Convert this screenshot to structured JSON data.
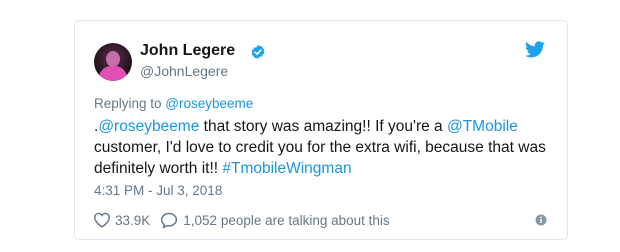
{
  "tweet": {
    "author_name": "John Legere",
    "handle": "@JohnLegere",
    "replying_prefix": "Replying to ",
    "replying_to": "@roseybeeme",
    "text": {
      "p1": ".",
      "mention1": "@roseybeeme",
      "p2": " that story was amazing!! If you're a ",
      "mention2": "@TMobile",
      "p3": " customer, I'd love to credit you for the extra wifi, because that was definitely worth it!! ",
      "hashtag": "#TmobileWingman"
    },
    "timestamp": "4:31 PM - Jul 3, 2018",
    "likes": "33.9K",
    "talking": "1,052 people are talking about this"
  },
  "icons": {
    "verified": "verified-badge-icon",
    "bird": "twitter-bird-icon",
    "heart": "heart-icon",
    "reply": "speech-bubble-icon",
    "info": "info-icon"
  },
  "colors": {
    "link": "#1b95e0",
    "muted": "#657786",
    "text": "#14171a",
    "border": "#e1e8ed"
  }
}
